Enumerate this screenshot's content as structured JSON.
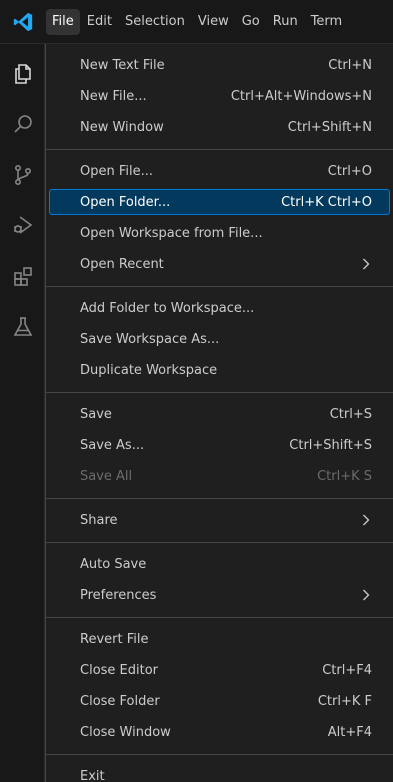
{
  "menubar": {
    "items": [
      "File",
      "Edit",
      "Selection",
      "View",
      "Go",
      "Run",
      "Term"
    ],
    "active_index": 0
  },
  "activitybar": {
    "icons": [
      "explorer-icon",
      "search-icon",
      "source-control-icon",
      "run-debug-icon",
      "extensions-icon",
      "testing-icon"
    ],
    "active": "explorer-icon"
  },
  "file_menu": {
    "groups": [
      [
        {
          "label": "New Text File",
          "shortcut": "Ctrl+N"
        },
        {
          "label": "New File...",
          "shortcut": "Ctrl+Alt+Windows+N"
        },
        {
          "label": "New Window",
          "shortcut": "Ctrl+Shift+N"
        }
      ],
      [
        {
          "label": "Open File...",
          "shortcut": "Ctrl+O"
        },
        {
          "label": "Open Folder...",
          "shortcut": "Ctrl+K Ctrl+O",
          "highlighted": true
        },
        {
          "label": "Open Workspace from File...",
          "shortcut": ""
        },
        {
          "label": "Open Recent",
          "shortcut": "",
          "submenu": true
        }
      ],
      [
        {
          "label": "Add Folder to Workspace...",
          "shortcut": ""
        },
        {
          "label": "Save Workspace As...",
          "shortcut": ""
        },
        {
          "label": "Duplicate Workspace",
          "shortcut": ""
        }
      ],
      [
        {
          "label": "Save",
          "shortcut": "Ctrl+S"
        },
        {
          "label": "Save As...",
          "shortcut": "Ctrl+Shift+S"
        },
        {
          "label": "Save All",
          "shortcut": "Ctrl+K S",
          "disabled": true
        }
      ],
      [
        {
          "label": "Share",
          "shortcut": "",
          "submenu": true
        }
      ],
      [
        {
          "label": "Auto Save",
          "shortcut": ""
        },
        {
          "label": "Preferences",
          "shortcut": "",
          "submenu": true
        }
      ],
      [
        {
          "label": "Revert File",
          "shortcut": ""
        },
        {
          "label": "Close Editor",
          "shortcut": "Ctrl+F4"
        },
        {
          "label": "Close Folder",
          "shortcut": "Ctrl+K F"
        },
        {
          "label": "Close Window",
          "shortcut": "Alt+F4"
        }
      ],
      [
        {
          "label": "Exit",
          "shortcut": ""
        }
      ]
    ]
  },
  "colors": {
    "accent": "#0078d4",
    "highlight_bg": "#04395e",
    "logo": "#23a9f2"
  }
}
